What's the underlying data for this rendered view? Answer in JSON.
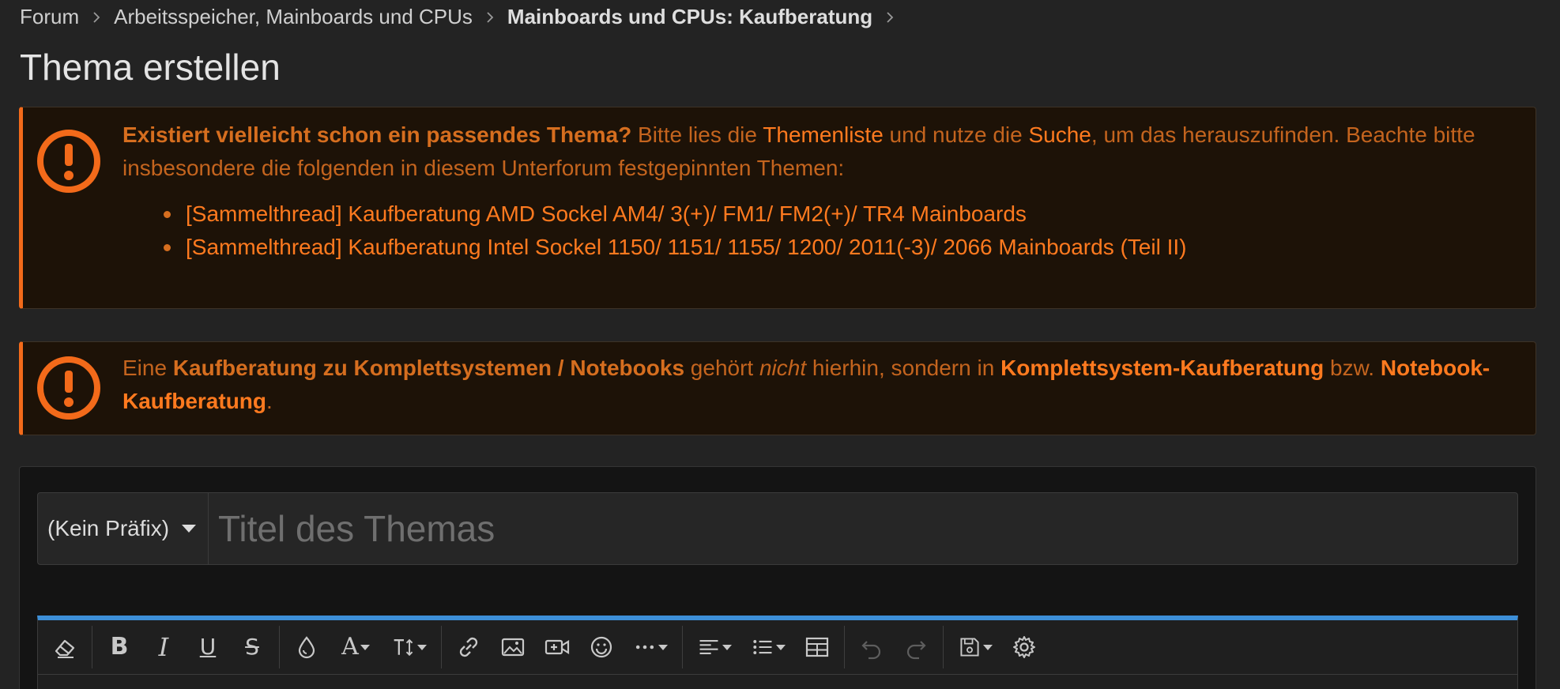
{
  "breadcrumb": {
    "items": [
      "Forum",
      "Arbeitsspeicher, Mainboards und CPUs",
      "Mainboards und CPUs: Kaufberatung"
    ]
  },
  "page": {
    "title": "Thema erstellen"
  },
  "notice1": {
    "lead_bold": "Existiert vielleicht schon ein passendes Thema?",
    "text1": " Bitte lies die ",
    "link_list": "Themenliste",
    "text2": " und nutze die ",
    "link_search": "Suche",
    "text3": ", um das herauszufinden. Beachte bitte insbesondere die folgenden in diesem Unterforum festgepinnten Themen:",
    "pinned": [
      "[Sammelthread] Kaufberatung AMD Sockel AM4/ 3(+)/ FM1/ FM2(+)/ TR4 Mainboards",
      "[Sammelthread] Kaufberatung Intel Sockel 1150/ 1151/ 1155/ 1200/ 2011(-3)/ 2066 Mainboards (Teil II)"
    ]
  },
  "notice2": {
    "text1": "Eine ",
    "bold1": "Kaufberatung zu Komplettsystemen / Notebooks",
    "text2": " gehört ",
    "italic": "nicht",
    "text3": " hierhin, sondern in ",
    "link1": "Komplettsystem-Kaufberatung",
    "text4": " bzw. ",
    "link2": "Notebook-Kaufberatung",
    "text5": "."
  },
  "form": {
    "prefix_value": "(Kein Präfix)",
    "title_placeholder": "Titel des Themas",
    "title_value": ""
  },
  "colors": {
    "accent": "#f36a1a",
    "link": "#ff7a1f",
    "editor_top": "#3d8fd8"
  },
  "toolbar": {
    "icons": [
      "eraser-icon",
      "bold-icon",
      "italic-icon",
      "underline-icon",
      "strikethrough-icon",
      "color-drop-icon",
      "font-family-icon",
      "font-size-icon",
      "link-icon",
      "image-icon",
      "video-icon",
      "smiley-icon",
      "more-icon",
      "align-icon",
      "list-icon",
      "table-icon",
      "undo-icon",
      "redo-icon",
      "save-draft-icon",
      "settings-gear-icon"
    ]
  }
}
